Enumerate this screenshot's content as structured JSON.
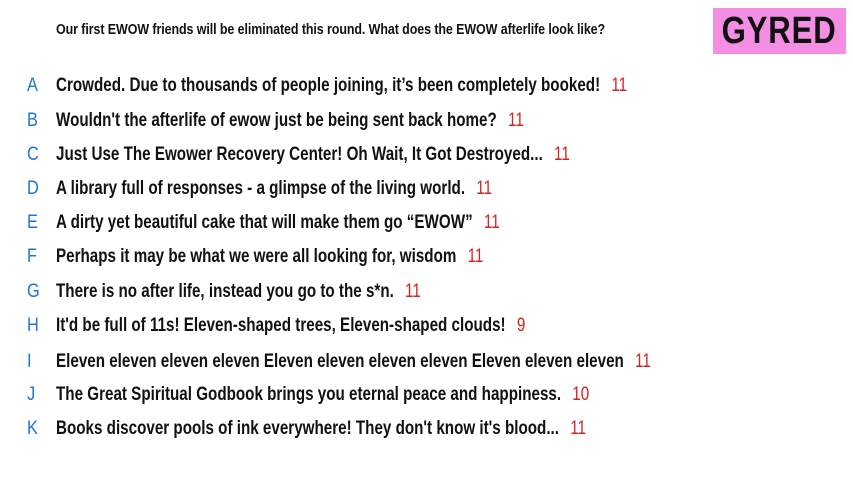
{
  "prompt": "Our first EWOW friends will be eliminated this round. What does the EWOW afterlife look like?",
  "badge": {
    "label": "GYRED",
    "color": "#f48ee3"
  },
  "colors": {
    "letter": "#1e73d6",
    "count": "#d22222",
    "text": "#111111"
  },
  "responses": [
    {
      "letter": "A",
      "text": "Crowded. Due to thousands of people joining, it’s been completely booked!",
      "count": "11"
    },
    {
      "letter": "B",
      "text": "Wouldn't the afterlife of ewow just be being sent back home?",
      "count": "11"
    },
    {
      "letter": "C",
      "text": "Just Use The Ewower Recovery Center! Oh Wait, It Got Destroyed...",
      "count": "11"
    },
    {
      "letter": "D",
      "text": "A library full of responses - a glimpse of the living world.",
      "count": "11"
    },
    {
      "letter": "E",
      "text": "A dirty yet beautiful cake that will make them go “EWOW”",
      "count": "11"
    },
    {
      "letter": "F",
      "text": "Perhaps it may be what we were all looking for, wisdom",
      "count": "11"
    },
    {
      "letter": "G",
      "text": "There is no after life, instead you go to the s*n.",
      "count": "11"
    },
    {
      "letter": "H",
      "text": "It'd be full of 11s! Eleven-shaped trees, Eleven-shaped clouds!",
      "count": "9"
    },
    {
      "letter": "I",
      "text": "Eleven eleven eleven eleven Eleven eleven eleven eleven Eleven eleven eleven",
      "count": "11"
    },
    {
      "letter": "J",
      "text": "The Great Spiritual Godbook brings you eternal peace and happiness.",
      "count": "10"
    },
    {
      "letter": "K",
      "text": "Books discover pools of ink everywhere! They don't know it's blood...",
      "count": "11"
    }
  ]
}
